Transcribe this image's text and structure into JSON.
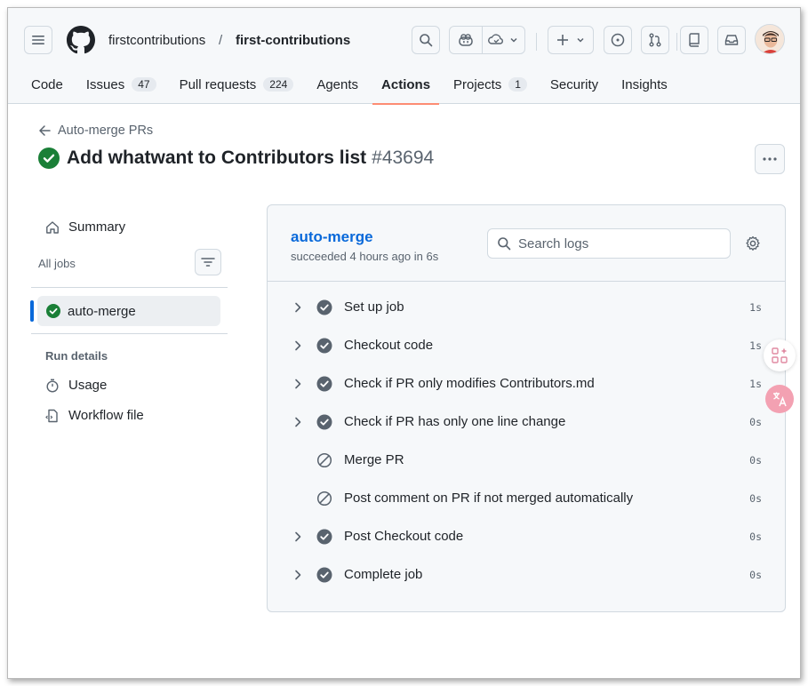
{
  "header": {
    "owner": "firstcontributions",
    "separator": "/",
    "repo": "first-contributions"
  },
  "tabs": [
    {
      "label": "Code",
      "count": ""
    },
    {
      "label": "Issues",
      "count": "47"
    },
    {
      "label": "Pull requests",
      "count": "224"
    },
    {
      "label": "Agents",
      "count": ""
    },
    {
      "label": "Actions",
      "count": "",
      "active": true
    },
    {
      "label": "Projects",
      "count": "1"
    },
    {
      "label": "Security",
      "count": ""
    },
    {
      "label": "Insights",
      "count": ""
    }
  ],
  "run": {
    "back_label": "Auto-merge PRs",
    "title": "Add whatwant to Contributors list",
    "number": "#43694"
  },
  "sidebar": {
    "summary": "Summary",
    "all_jobs": "All jobs",
    "job": "auto-merge",
    "run_details": "Run details",
    "usage": "Usage",
    "workflow_file": "Workflow file"
  },
  "job_panel": {
    "name": "auto-merge",
    "status": "succeeded 4 hours ago in 6s",
    "search_placeholder": "Search logs",
    "steps": [
      {
        "label": "Set up job",
        "duration": "1s",
        "status": "success",
        "expandable": true
      },
      {
        "label": "Checkout code",
        "duration": "1s",
        "status": "success",
        "expandable": true
      },
      {
        "label": "Check if PR only modifies Contributors.md",
        "duration": "1s",
        "status": "success",
        "expandable": true
      },
      {
        "label": "Check if PR has only one line change",
        "duration": "0s",
        "status": "success",
        "expandable": true
      },
      {
        "label": "Merge PR",
        "duration": "0s",
        "status": "skipped",
        "expandable": false
      },
      {
        "label": "Post comment on PR if not merged automatically",
        "duration": "0s",
        "status": "skipped",
        "expandable": false
      },
      {
        "label": "Post Checkout code",
        "duration": "0s",
        "status": "success",
        "expandable": true
      },
      {
        "label": "Complete job",
        "duration": "0s",
        "status": "success",
        "expandable": true
      }
    ]
  },
  "colors": {
    "success": "#1a7f37",
    "link": "#0969da",
    "active_tab": "#fd8c73"
  },
  "icons": [
    "menu-icon",
    "github-logo-icon",
    "search-icon",
    "copilot-icon",
    "copilot-dropdown-icon",
    "plus-icon",
    "issues-icon",
    "pull-request-icon",
    "repo-icon",
    "inbox-icon",
    "arrow-left-icon",
    "check-circle-icon",
    "kebab-icon",
    "home-icon",
    "filter-icon",
    "stopwatch-icon",
    "workflow-icon",
    "gear-icon",
    "chevron-right-icon",
    "skipped-icon"
  ]
}
